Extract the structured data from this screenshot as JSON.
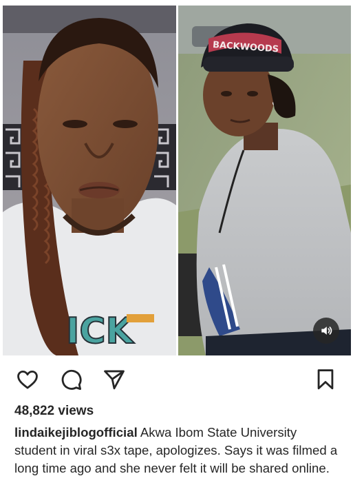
{
  "post": {
    "views": "48,822 views",
    "username": "lindaikejiblogofficial",
    "caption": "Akwa Ibom State University student in viral s3x tape, apologizes. Says it was filmed a long time ago and she never felt it will be shared online.",
    "photo_left_shirt_text": "ICK",
    "photo_right_cap_text": "BACKWOODS"
  },
  "icons": {
    "like": "heart-icon",
    "comment": "speech-bubble-icon",
    "share": "paper-plane-icon",
    "save": "bookmark-icon",
    "sound": "speaker-icon"
  },
  "colors": {
    "text": "#262626",
    "background": "#ffffff",
    "sound_button": "#262626"
  }
}
